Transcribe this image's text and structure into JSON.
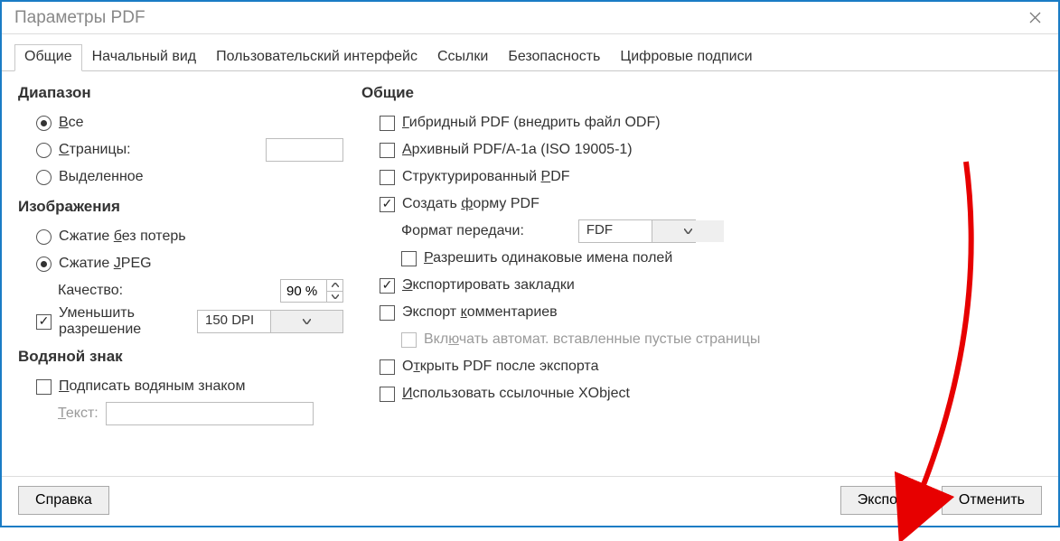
{
  "window": {
    "title": "Параметры PDF"
  },
  "tabs": {
    "general": "Общие",
    "initial_view": "Начальный вид",
    "ui": "Пользовательский интерфейс",
    "links": "Ссылки",
    "security": "Безопасность",
    "signatures": "Цифровые подписи"
  },
  "left": {
    "range_heading": "Диапазон",
    "range_all": "Все",
    "range_pages": "Страницы:",
    "range_pages_value": "",
    "range_selection": "Выделенное",
    "images_heading": "Изображения",
    "img_lossless": "Сжатие без потерь",
    "img_jpeg": "Сжатие JPEG",
    "quality_label": "Качество:",
    "quality_value": "90 %",
    "reduce_res": "Уменьшить разрешение",
    "dpi_value": "150 DPI",
    "watermark_heading": "Водяной знак",
    "watermark_sign": "Подписать водяным знаком",
    "watermark_text_label": "Текст:",
    "watermark_text_value": ""
  },
  "right": {
    "general_heading": "Общие",
    "hybrid": "Гибридный PDF (внедрить файл ODF)",
    "archive": "Архивный PDF/A-1a (ISO 19005-1)",
    "tagged": "Структурированный PDF",
    "create_form": "Создать форму PDF",
    "submit_format_label": "Формат передачи:",
    "submit_format_value": "FDF",
    "allow_dup": "Разрешить одинаковые имена полей",
    "export_bookmarks": "Экспортировать закладки",
    "export_comments": "Экспорт комментариев",
    "auto_blank": "Включать автомат. вставленные пустые страницы",
    "open_after": "Открыть PDF после экспорта",
    "xobject": "Использовать ссылочные XObject"
  },
  "footer": {
    "help": "Справка",
    "export": "Экспорт",
    "cancel": "Отменить"
  }
}
